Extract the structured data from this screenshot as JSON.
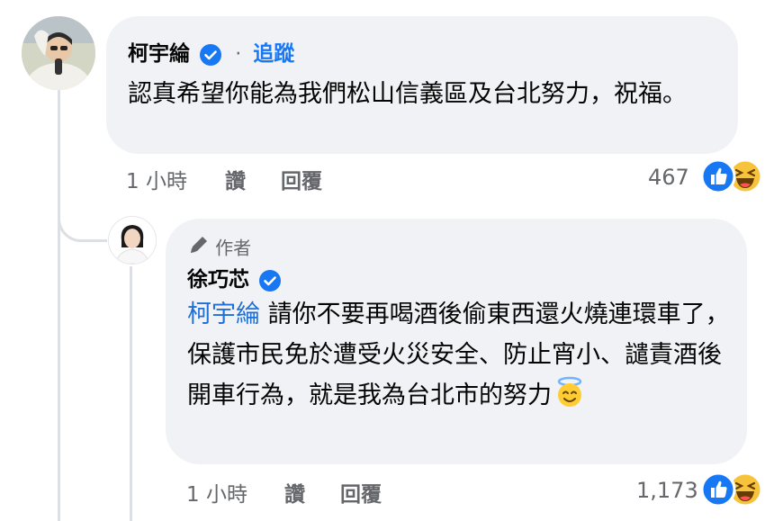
{
  "comment": {
    "author": "柯宇綸",
    "follow_separator": "·",
    "follow_label": "追蹤",
    "text": "認真希望你能為我們松山信義區及台北努力，祝福。",
    "time": "1 小時",
    "like_label": "讚",
    "reply_label": "回覆",
    "reaction_count": "467",
    "reactions": [
      "like-icon",
      "haha-icon"
    ]
  },
  "reply": {
    "author_badge": "作者",
    "author": "徐巧芯",
    "mention": "柯宇綸",
    "text": "請你不要再喝酒後偷東西還火燒連環車了，保護市民免於遭受火災安全、防止宵小、譴責酒後開車行為，就是我為台北市的努力",
    "emoji": "smiling-face-with-halo-icon",
    "time": "1 小時",
    "like_label": "讚",
    "reply_label": "回覆",
    "reaction_count": "1,173",
    "reactions": [
      "like-icon",
      "haha-icon"
    ]
  },
  "colors": {
    "bubble": "#f0f2f5",
    "link": "#1f6fd8",
    "verified": "#1877f2",
    "meta": "#65676b"
  }
}
